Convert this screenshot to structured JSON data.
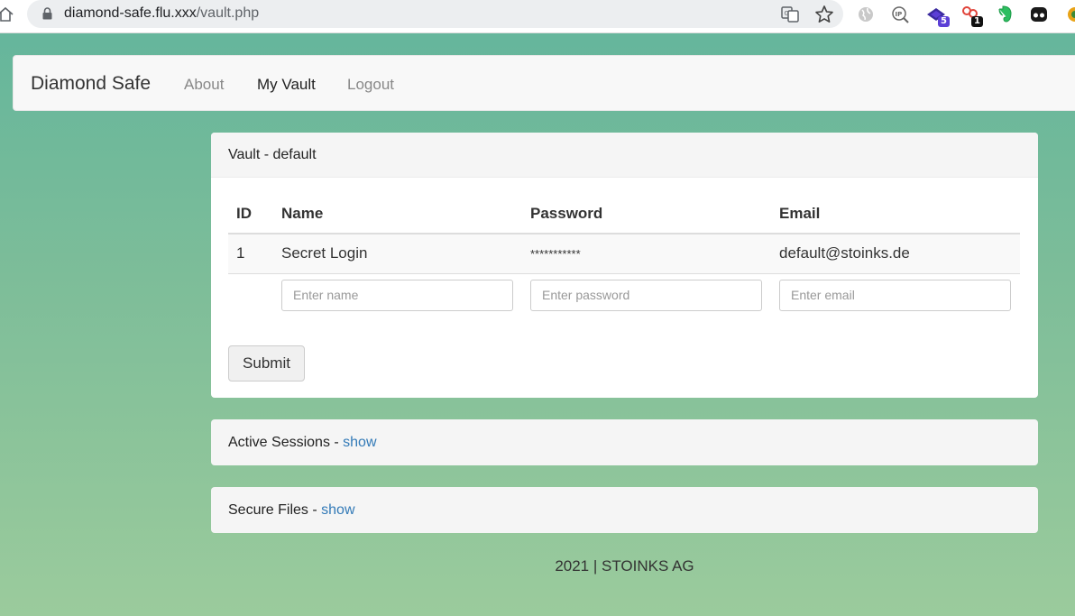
{
  "browser": {
    "url_domain": "diamond-safe.flu.xxx",
    "url_path": "/vault.php",
    "extensions": [
      {
        "name": "translate-icon"
      },
      {
        "name": "bookmark-star-icon"
      },
      {
        "name": "globe-icon"
      },
      {
        "name": "ip-lookup-icon"
      },
      {
        "name": "extension-purple-icon",
        "badge": "5",
        "badge_color": "#5b3fd6"
      },
      {
        "name": "extension-red-icon",
        "badge": "1",
        "badge_color": "#111111"
      },
      {
        "name": "evernote-icon"
      },
      {
        "name": "incognito-icon"
      }
    ]
  },
  "navbar": {
    "brand": "Diamond Safe",
    "links": [
      "About",
      "My Vault",
      "Logout"
    ],
    "active": "My Vault"
  },
  "vault": {
    "heading": "Vault - default",
    "columns": [
      "ID",
      "Name",
      "Password",
      "Email"
    ],
    "rows": [
      {
        "id": "1",
        "name": "Secret Login",
        "password": "***********",
        "email": "default@stoinks.de"
      }
    ],
    "form": {
      "name_placeholder": "Enter name",
      "password_placeholder": "Enter password",
      "email_placeholder": "Enter email",
      "submit_label": "Submit"
    }
  },
  "sessions": {
    "heading": "Active Sessions - ",
    "link": "show"
  },
  "files": {
    "heading": "Secure Files - ",
    "link": "show"
  },
  "footer": {
    "text": "2021 | STOINKS AG"
  },
  "colors": {
    "link": "#337ab7",
    "background_top": "#62b59c",
    "background_bottom": "#9bcb9c"
  }
}
